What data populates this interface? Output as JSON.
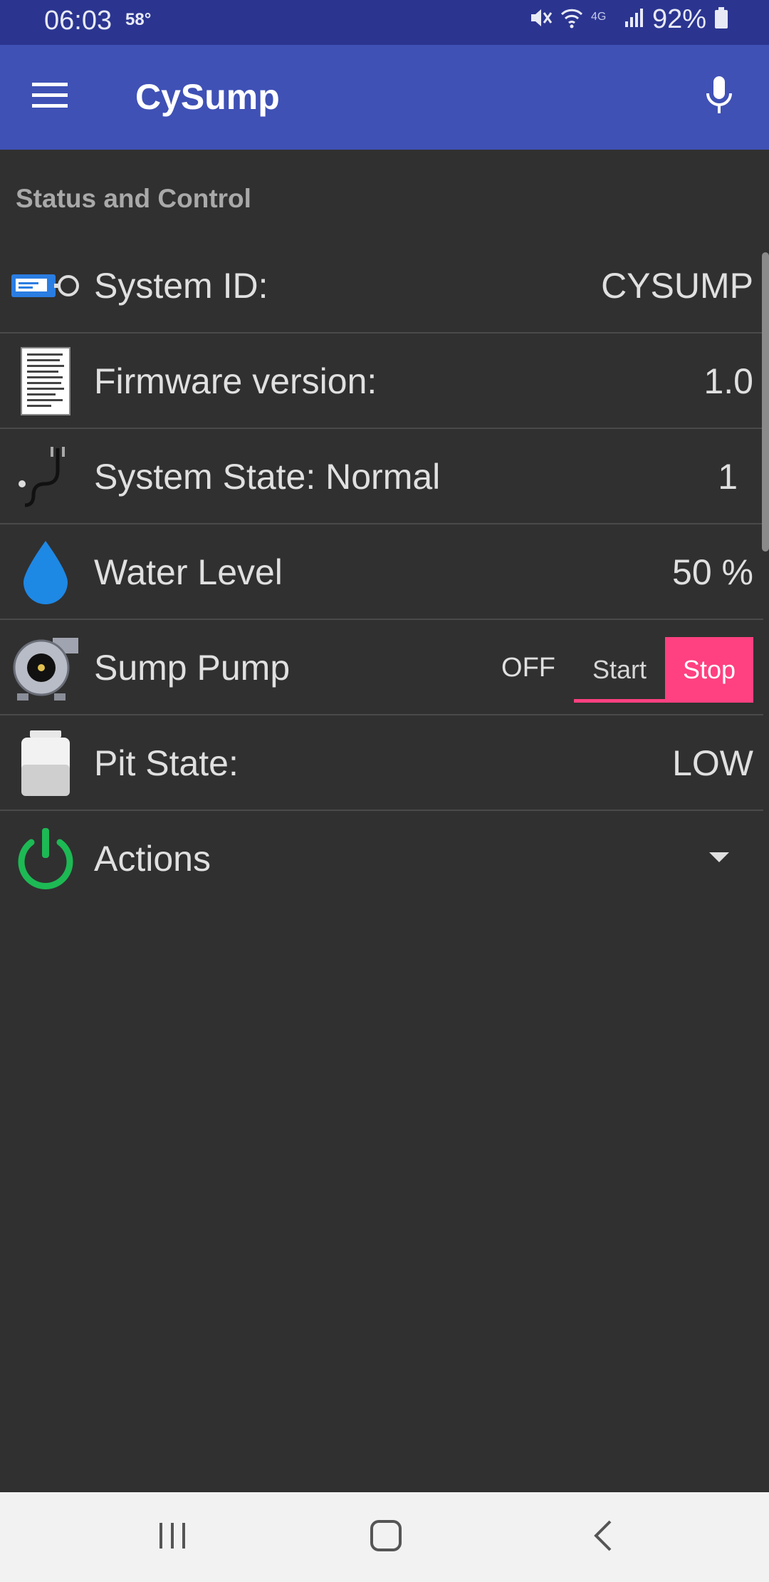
{
  "status_bar": {
    "time": "06:03",
    "temperature": "58°",
    "battery": "92%",
    "icons": [
      "mute-icon",
      "wifi-icon",
      "4g-icon",
      "signal-icon",
      "battery-icon"
    ]
  },
  "app_bar": {
    "title": "CySump",
    "menu_icon": "hamburger-menu-icon",
    "mic_icon": "microphone-icon",
    "color": "#3f51b5"
  },
  "section": {
    "title": "Status and Control"
  },
  "rows": [
    {
      "icon": "id-card-icon",
      "label": "System ID:",
      "value": "CYSUMP"
    },
    {
      "icon": "document-icon",
      "label": "Firmware version:",
      "value": "1.0"
    },
    {
      "icon": "stethoscope-icon",
      "label": "System State: Normal",
      "value": "1"
    },
    {
      "icon": "water-drop-icon",
      "label": "Water Level",
      "value": "50 %"
    },
    {
      "icon": "pump-icon",
      "label": "Sump Pump",
      "state": "OFF",
      "start_label": "Start",
      "stop_label": "Stop"
    },
    {
      "icon": "jar-icon",
      "label": "Pit State:",
      "value": "LOW"
    },
    {
      "icon": "power-icon",
      "label": "Actions",
      "dropdown_icon": "dropdown-arrow-icon"
    }
  ],
  "accent_color": "#ff4081",
  "nav_bar": {
    "icons": [
      "recent-apps-icon",
      "home-icon",
      "back-icon"
    ]
  }
}
